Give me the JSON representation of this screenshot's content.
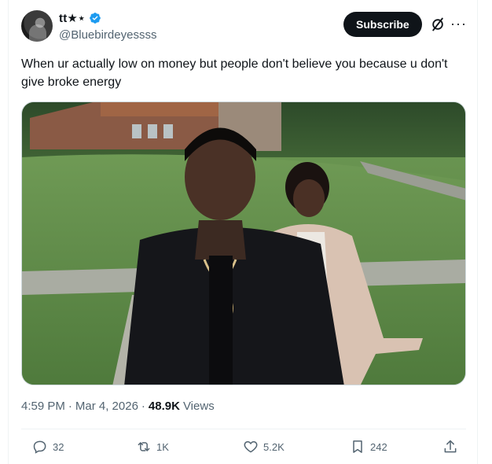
{
  "author": {
    "display_name": "tt★⋆",
    "handle": "@Bluebirdeyessss",
    "verified": true
  },
  "header": {
    "subscribe_label": "Subscribe"
  },
  "tweet": {
    "text": "When ur actually low on money but people don't believe you because u don't give broke energy"
  },
  "meta": {
    "time": "4:59 PM",
    "date": "Mar 4, 2026",
    "views_count": "48.9K",
    "views_label": "Views"
  },
  "actions": {
    "replies": "32",
    "reposts": "1K",
    "likes": "5.2K",
    "bookmarks": "242"
  },
  "colors": {
    "text": "#0f1419",
    "secondary": "#536471",
    "verified": "#1d9bf0",
    "border": "#eff3f4"
  }
}
